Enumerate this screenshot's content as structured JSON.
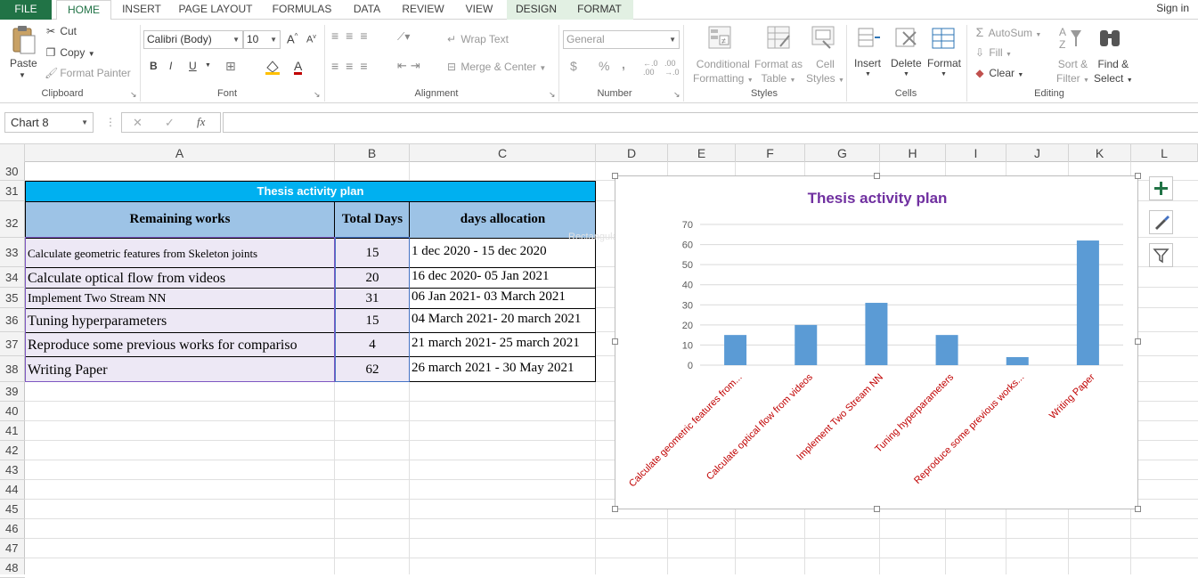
{
  "ribbon_tabs": {
    "file": "FILE",
    "home": "HOME",
    "insert": "INSERT",
    "page_layout": "PAGE LAYOUT",
    "formulas": "FORMULAS",
    "data": "DATA",
    "review": "REVIEW",
    "view": "VIEW",
    "design": "DESIGN",
    "format": "FORMAT",
    "signin": "Sign in"
  },
  "clipboard": {
    "paste": "Paste",
    "cut": "Cut",
    "copy": "Copy",
    "format_painter": "Format Painter",
    "label": "Clipboard"
  },
  "font": {
    "name": "Calibri (Body)",
    "size": "10",
    "bold": "B",
    "italic": "I",
    "underline": "U",
    "label": "Font"
  },
  "alignment": {
    "wrap_text": "Wrap Text",
    "merge_center": "Merge & Center",
    "label": "Alignment"
  },
  "number": {
    "format": "General",
    "currency": "$",
    "percent": "%",
    "comma": ",",
    "label": "Number"
  },
  "styles": {
    "conditional_1": "Conditional",
    "conditional_2": "Formatting",
    "format_as_1": "Format as",
    "format_as_2": "Table",
    "cell_styles_1": "Cell",
    "cell_styles_2": "Styles",
    "label": "Styles"
  },
  "cells": {
    "insert": "Insert",
    "delete": "Delete",
    "format": "Format",
    "label": "Cells"
  },
  "editing": {
    "autosum": "AutoSum",
    "fill": "Fill",
    "clear": "Clear",
    "sort_1": "Sort &",
    "sort_2": "Filter",
    "find_1": "Find &",
    "find_2": "Select",
    "label": "Editing"
  },
  "formula_bar": {
    "name_box": "Chart 8",
    "fx": "fx",
    "cancel": "✕",
    "enter": "✓"
  },
  "columns": [
    "A",
    "B",
    "C",
    "D",
    "E",
    "F",
    "G",
    "H",
    "I",
    "J",
    "K",
    "L"
  ],
  "rows": [
    "30",
    "31",
    "32",
    "33",
    "34",
    "35",
    "36",
    "37",
    "38",
    "39",
    "40",
    "41",
    "42",
    "43",
    "44",
    "45",
    "46",
    "47",
    "48"
  ],
  "table": {
    "title": "Thesis activity plan",
    "headers": [
      "Remaining works",
      "Total Days",
      "days allocation"
    ],
    "rows": [
      {
        "work": "Calculate geometric features from Skeleton joints",
        "days": "15",
        "alloc": "1 dec 2020 - 15 dec 2020"
      },
      {
        "work": "Calculate optical flow from videos",
        "days": "20",
        "alloc": "16 dec 2020- 05 Jan 2021"
      },
      {
        "work": "Implement Two Stream NN",
        "days": "31",
        "alloc": "06 Jan 2021- 03 March 2021"
      },
      {
        "work": "Tuning hyperparameters",
        "days": "15",
        "alloc": "04 March 2021- 20 march 2021"
      },
      {
        "work": "Reproduce some previous works for compariso",
        "days": "4",
        "alloc": "21  march 2021- 25 march 2021"
      },
      {
        "work": "Writing Paper",
        "days": "62",
        "alloc": "26 march 2021 - 30 May 2021"
      }
    ]
  },
  "overlay_text": "Rectangular Snip",
  "colors": {
    "accent": "#217346",
    "title_bar": "#00b0f0",
    "header_fill": "#9dc3e6",
    "row_fill": "#ede8f5",
    "bar": "#5b9bd5",
    "chart_title": "#7030a0",
    "tick_label": "#c00000"
  },
  "chart_data": {
    "type": "bar",
    "title": "Thesis activity plan",
    "categories": [
      "Calculate geometric features from...",
      "Calculate optical flow from videos",
      "Implement Two Stream NN",
      "Tuning hyperparameters",
      "Reproduce some previous works...",
      "Writing Paper"
    ],
    "values": [
      15,
      20,
      31,
      15,
      4,
      62
    ],
    "ylim": [
      0,
      70
    ],
    "yticks": [
      "0",
      "10",
      "20",
      "30",
      "40",
      "50",
      "60",
      "70"
    ],
    "grid": true,
    "legend": "none"
  }
}
